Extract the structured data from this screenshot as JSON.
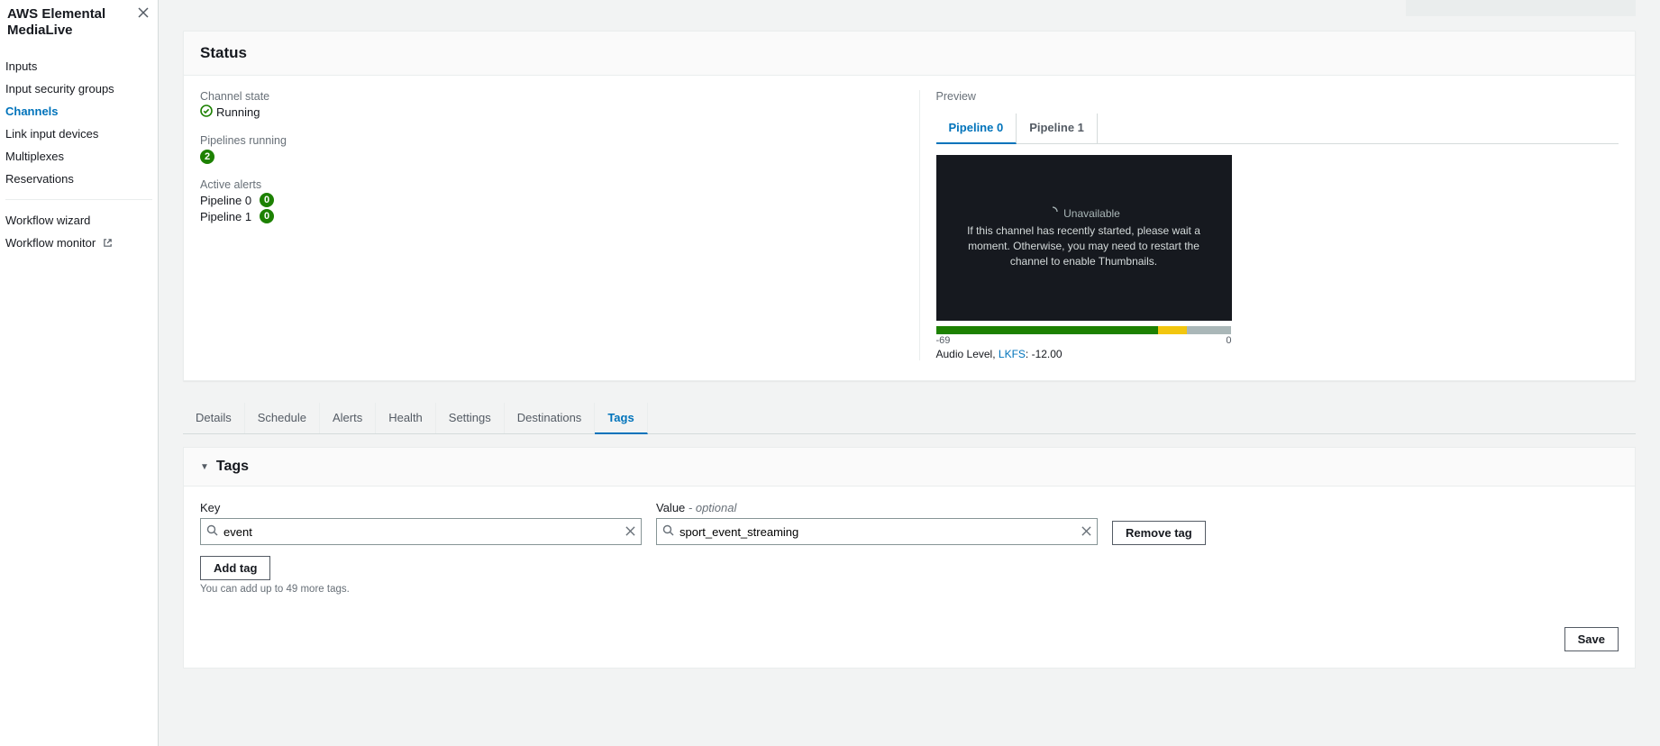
{
  "sidebar": {
    "title": "AWS Elemental MediaLive",
    "nav": [
      {
        "label": "Inputs"
      },
      {
        "label": "Input security groups"
      },
      {
        "label": "Channels"
      },
      {
        "label": "Link input devices"
      },
      {
        "label": "Multiplexes"
      },
      {
        "label": "Reservations"
      }
    ],
    "nav2": [
      {
        "label": "Workflow wizard"
      },
      {
        "label": "Workflow monitor"
      }
    ]
  },
  "status": {
    "heading": "Status",
    "channel_state_label": "Channel state",
    "channel_state_value": "Running",
    "pipelines_label": "Pipelines running",
    "pipelines_count": "2",
    "alerts_label": "Active alerts",
    "alerts": [
      {
        "name": "Pipeline 0",
        "count": "0"
      },
      {
        "name": "Pipeline 1",
        "count": "0"
      }
    ],
    "preview": {
      "label": "Preview",
      "tabs": [
        "Pipeline 0",
        "Pipeline 1"
      ],
      "active_tab": 0,
      "unavailable_title": "Unavailable",
      "unavailable_msg": "If this channel has recently started, please wait a moment. Otherwise, you may need to restart the channel to enable Thumbnails.",
      "audio_scale_min": "-69",
      "audio_scale_max": "0",
      "audio_label_prefix": "Audio Level, ",
      "audio_link": "LKFS",
      "audio_value": ": -12.00"
    }
  },
  "tabs": [
    "Details",
    "Schedule",
    "Alerts",
    "Health",
    "Settings",
    "Destinations",
    "Tags"
  ],
  "tabs_active": 6,
  "tags": {
    "header": "Tags",
    "key_label": "Key",
    "value_label": "Value",
    "value_optional": " - optional",
    "key_value": "event",
    "val_value": "sport_event_streaming",
    "remove_label": "Remove tag",
    "add_label": "Add tag",
    "hint": "You can add up to 49 more tags.",
    "save_label": "Save"
  }
}
